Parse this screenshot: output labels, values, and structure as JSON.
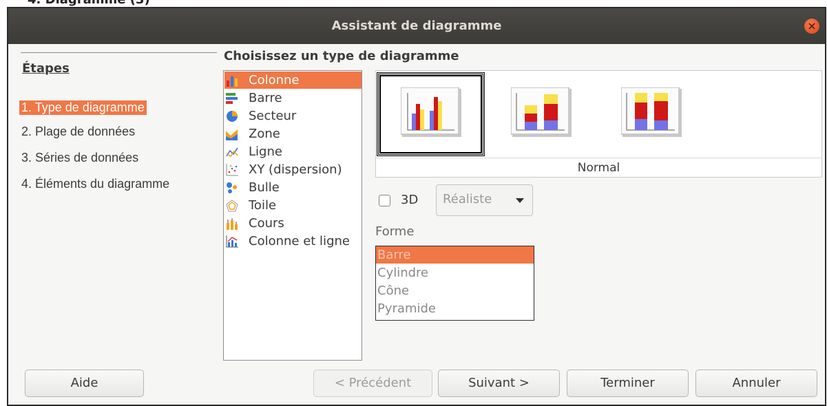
{
  "top_cutoff_text": "4. Diagramme (3)",
  "window": {
    "title": "Assistant de diagramme"
  },
  "steps": {
    "title": "Étapes",
    "items": [
      {
        "label": "1. Type de diagramme",
        "active": true
      },
      {
        "label": "2. Plage de données",
        "active": false
      },
      {
        "label": "3. Séries de données",
        "active": false
      },
      {
        "label": "4. Éléments du diagramme",
        "active": false
      }
    ]
  },
  "chart_type": {
    "heading": "Choisissez un type de diagramme",
    "types": [
      {
        "label": "Colonne",
        "icon": "column-chart-icon",
        "selected": true
      },
      {
        "label": "Barre",
        "icon": "bar-chart-icon"
      },
      {
        "label": "Secteur",
        "icon": "pie-chart-icon"
      },
      {
        "label": "Zone",
        "icon": "area-chart-icon"
      },
      {
        "label": "Ligne",
        "icon": "line-chart-icon"
      },
      {
        "label": "XY (dispersion)",
        "icon": "scatter-chart-icon"
      },
      {
        "label": "Bulle",
        "icon": "bubble-chart-icon"
      },
      {
        "label": "Toile",
        "icon": "net-chart-icon"
      },
      {
        "label": "Cours",
        "icon": "stock-chart-icon"
      },
      {
        "label": "Colonne et ligne",
        "icon": "column-line-chart-icon"
      }
    ],
    "variant_selected_label": "Normal"
  },
  "options": {
    "three_d_label": "3D",
    "three_d_checked": false,
    "style_value": "Réaliste",
    "shape_label": "Forme",
    "shapes": [
      "Barre",
      "Cylindre",
      "Cône",
      "Pyramide"
    ],
    "shape_selected": "Barre"
  },
  "buttons": {
    "help": "Aide",
    "previous": "< Précédent",
    "next": "Suivant >",
    "finish": "Terminer",
    "cancel": "Annuler"
  },
  "colors": {
    "accent": "#f07746",
    "titlebar": "#3c3b37",
    "close": "#e35a2a"
  }
}
